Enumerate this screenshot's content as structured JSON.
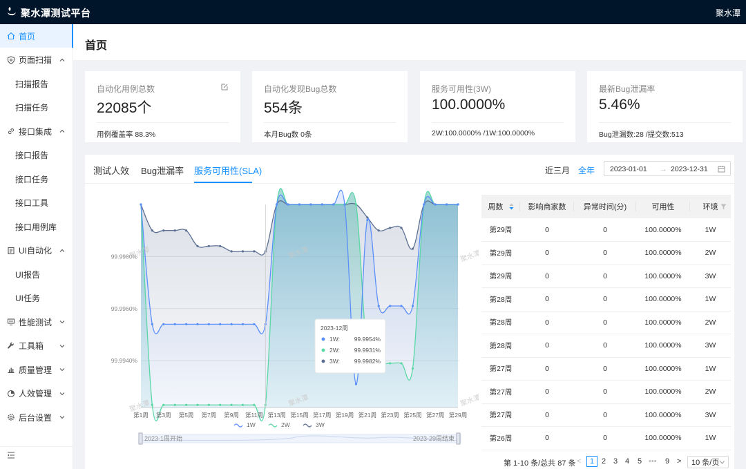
{
  "header": {
    "title": "聚水潭测试平台",
    "user": "聚水潭"
  },
  "sidebar": {
    "items": [
      {
        "label": "首页",
        "icon": "home-icon",
        "active": true,
        "sub": false
      },
      {
        "label": "页面扫描",
        "icon": "shield-icon",
        "expanded": true,
        "sub": false
      },
      {
        "label": "扫描报告",
        "sub": true
      },
      {
        "label": "扫描任务",
        "sub": true
      },
      {
        "label": "接口集成",
        "icon": "link-icon",
        "expanded": true,
        "sub": false
      },
      {
        "label": "接口报告",
        "sub": true
      },
      {
        "label": "接口任务",
        "sub": true
      },
      {
        "label": "接口工具",
        "sub": true
      },
      {
        "label": "接口用例库",
        "sub": true
      },
      {
        "label": "UI自动化",
        "icon": "document-icon",
        "expanded": true,
        "sub": false
      },
      {
        "label": "UI报告",
        "sub": true
      },
      {
        "label": "UI任务",
        "sub": true
      },
      {
        "label": "性能测试",
        "icon": "monitor-icon",
        "expanded": false,
        "sub": false
      },
      {
        "label": "工具箱",
        "icon": "wrench-icon",
        "expanded": false,
        "sub": false
      },
      {
        "label": "质量管理",
        "icon": "bar-chart-icon",
        "expanded": false,
        "sub": false
      },
      {
        "label": "人效管理",
        "icon": "pie-chart-icon",
        "expanded": false,
        "sub": false
      },
      {
        "label": "后台设置",
        "icon": "gear-icon",
        "expanded": false,
        "sub": false
      }
    ]
  },
  "page": {
    "title": "首页"
  },
  "cards": [
    {
      "label": "自动化用例总数",
      "value": "22085个",
      "sub": "用例覆盖率  88.3%"
    },
    {
      "label": "自动化发现Bug总数",
      "value": "554条",
      "sub": "本月Bug数  0条"
    },
    {
      "label": "服务可用性(3W)",
      "value": "100.0000%",
      "sub": " 2W:100.0000% /1W:100.0000%"
    },
    {
      "label": "最新Bug泄漏率",
      "value": "5.46%",
      "sub": " Bug泄漏数:28 /提交数:513"
    }
  ],
  "tabs": [
    {
      "label": "测试人效"
    },
    {
      "label": "Bug泄漏率"
    },
    {
      "label": "服务可用性(SLA)",
      "active": true
    }
  ],
  "range": {
    "recent3": "近三月",
    "all": "全年",
    "start": "2023-01-01",
    "end": "2023-12-31"
  },
  "watermark": "聚水潭",
  "colors": {
    "primary": "#1890ff",
    "w1": "#5b8ff9",
    "w2": "#5ad8a6",
    "w3": "#5d7092"
  },
  "chart_data": {
    "type": "area",
    "x": [
      "第1周",
      "第2周",
      "第3周",
      "第4周",
      "第5周",
      "第6周",
      "第7周",
      "第8周",
      "第9周",
      "第10周",
      "第11周",
      "第12周",
      "第13周",
      "第14周",
      "第15周",
      "第16周",
      "第17周",
      "第18周",
      "第19周",
      "第20周",
      "第21周",
      "第22周",
      "第23周",
      "第24周",
      "第25周",
      "第26周",
      "第27周",
      "第28周",
      "第29周"
    ],
    "x_tick_labels": [
      "第1周",
      "第3周",
      "第5周",
      "第7周",
      "第9周",
      "第11周",
      "第13周",
      "第15周",
      "第17周",
      "第19周",
      "第21周",
      "第23周",
      "第25周",
      "第27周",
      "第29周"
    ],
    "y_ticks": [
      "99.9940%",
      "99.9960%",
      "99.9980%"
    ],
    "ylim": [
      99.9922,
      100.0
    ],
    "series": [
      {
        "name": "1W",
        "values": [
          100.0,
          99.9954,
          99.9954,
          99.9954,
          99.9954,
          99.9954,
          99.9954,
          99.9954,
          99.9954,
          99.9954,
          99.9954,
          99.9954,
          100.0,
          100.0,
          100.0,
          100.0,
          100.0,
          100.0,
          100.0,
          99.9931,
          99.9994,
          99.9961,
          99.9961,
          99.9961,
          99.9961,
          100.0,
          100.0,
          100.0,
          100.0
        ]
      },
      {
        "name": "2W",
        "values": [
          100.0,
          99.9923,
          99.9923,
          99.9923,
          99.9923,
          99.9923,
          99.9923,
          99.9923,
          99.9923,
          99.9923,
          99.9923,
          99.9923,
          100.0,
          100.0,
          100.0,
          100.0,
          100.0,
          100.0,
          100.0,
          100.0,
          99.9942,
          99.9939,
          99.9939,
          99.9939,
          99.9937,
          100.0,
          100.0,
          100.0,
          100.0
        ]
      },
      {
        "name": "3W",
        "values": [
          100.0,
          99.999,
          99.999,
          99.999,
          99.999,
          99.9984,
          99.9984,
          99.9984,
          99.9982,
          99.9982,
          99.9982,
          99.9982,
          100.0,
          100.0,
          100.0,
          100.0,
          100.0,
          100.0,
          100.0,
          100.0,
          99.9995,
          99.999,
          99.9991,
          99.9991,
          99.9983,
          100.0,
          100.0,
          100.0,
          100.0
        ]
      }
    ],
    "tooltip": {
      "title": "2023-12周",
      "rows": [
        {
          "name": "1W:",
          "value": "99.9954%"
        },
        {
          "name": "2W:",
          "value": "99.9931%"
        },
        {
          "name": "3W:",
          "value": "99.9982%"
        }
      ]
    },
    "datazoom": {
      "start_label": "2023-1周开始",
      "end_label": "2023-29周结束"
    },
    "legend": "bottom"
  },
  "table": {
    "headers": [
      "周数",
      "影响商家数",
      "异常时间(分)",
      "可用性",
      "环境"
    ],
    "rows": [
      [
        "第29周",
        "0",
        "0",
        "100.0000%",
        "1W"
      ],
      [
        "第29周",
        "0",
        "0",
        "100.0000%",
        "2W"
      ],
      [
        "第29周",
        "0",
        "0",
        "100.0000%",
        "3W"
      ],
      [
        "第28周",
        "0",
        "0",
        "100.0000%",
        "1W"
      ],
      [
        "第28周",
        "0",
        "0",
        "100.0000%",
        "2W"
      ],
      [
        "第28周",
        "0",
        "0",
        "100.0000%",
        "3W"
      ],
      [
        "第27周",
        "0",
        "0",
        "100.0000%",
        "1W"
      ],
      [
        "第27周",
        "0",
        "0",
        "100.0000%",
        "2W"
      ],
      [
        "第27周",
        "0",
        "0",
        "100.0000%",
        "3W"
      ],
      [
        "第26周",
        "0",
        "0",
        "100.0000%",
        "1W"
      ]
    ]
  },
  "pager": {
    "summary": "第 1-10 条/总共 87 条",
    "pages": [
      "1",
      "2",
      "3",
      "4",
      "5"
    ],
    "ellipsis": "•••",
    "last": "9",
    "page_size": "10 条/页",
    "prev": "<",
    "next": ">"
  }
}
